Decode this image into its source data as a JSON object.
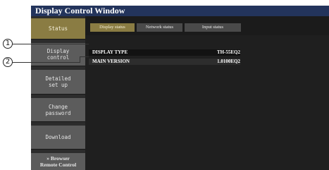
{
  "window": {
    "title": "Display Control Window"
  },
  "sidebar": {
    "items": [
      {
        "lines": [
          "Status"
        ]
      },
      {
        "lines": [
          "Display",
          "control"
        ]
      },
      {
        "lines": [
          "Detailed",
          "set up"
        ]
      },
      {
        "lines": [
          "Change",
          "password"
        ]
      },
      {
        "lines": [
          "Download"
        ]
      },
      {
        "lines": [
          "» Browser",
          "Remote Control"
        ]
      }
    ]
  },
  "tabs": [
    "Display status",
    "Network status",
    "Input status"
  ],
  "info": [
    {
      "label": "DISPLAY TYPE",
      "value": "TH-55EQ2"
    },
    {
      "label": "MAIN VERSION",
      "value": "1.0100EQ2"
    }
  ],
  "callouts": [
    "1",
    "2"
  ],
  "colors": {
    "title_bar": "#23345c",
    "active": "#8a7c43",
    "inactive": "#5c5c5c",
    "background": "#1b1b1b"
  }
}
